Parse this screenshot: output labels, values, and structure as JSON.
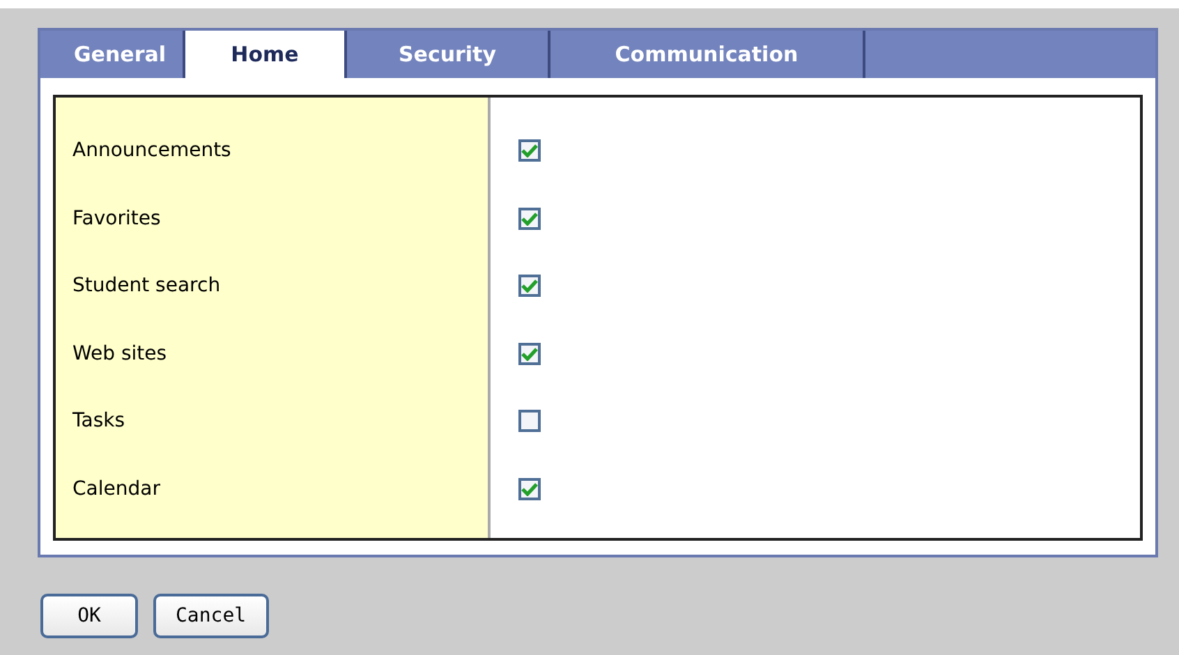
{
  "tabs": [
    {
      "label": "General",
      "selected": false
    },
    {
      "label": "Home",
      "selected": true
    },
    {
      "label": "Security",
      "selected": false
    },
    {
      "label": "Communication",
      "selected": false
    }
  ],
  "settings": [
    {
      "label": "Announcements",
      "checked": true
    },
    {
      "label": "Favorites",
      "checked": true
    },
    {
      "label": "Student search",
      "checked": true
    },
    {
      "label": "Web sites",
      "checked": true
    },
    {
      "label": "Tasks",
      "checked": false
    },
    {
      "label": "Calendar",
      "checked": true
    }
  ],
  "buttons": [
    "OK",
    "Cancel"
  ]
}
